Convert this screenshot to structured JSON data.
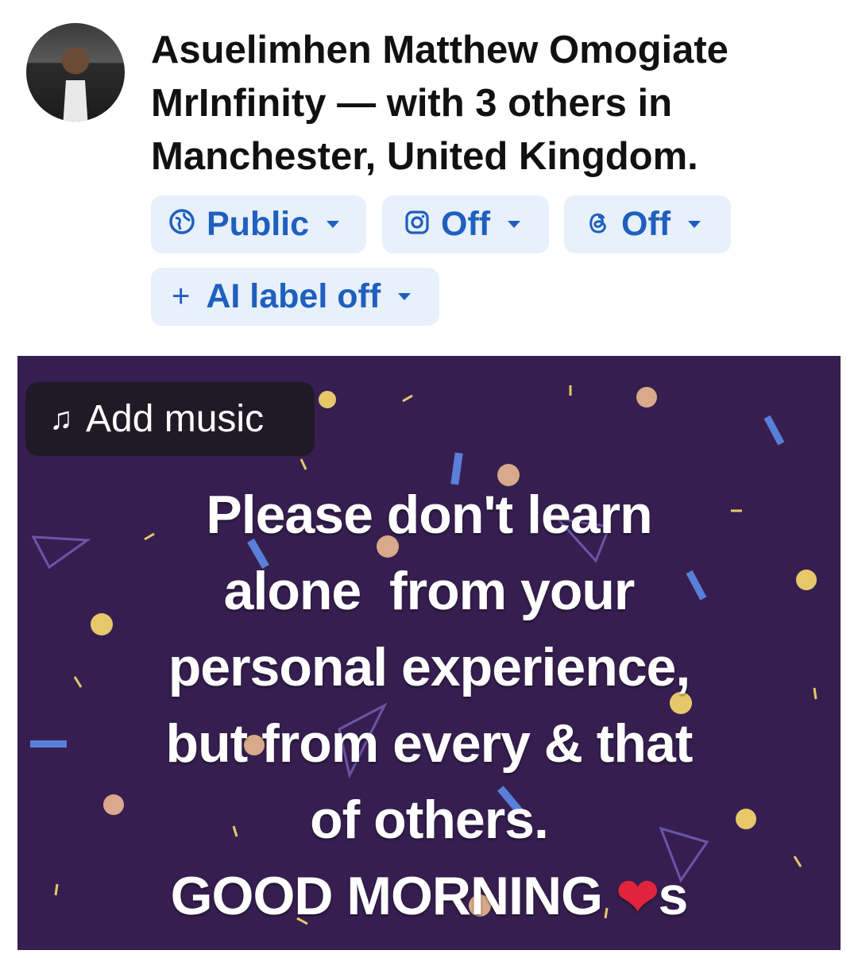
{
  "author": {
    "text": "Asuelimhen Matthew Omogiate MrInfinity — with 3 others in Manchester, United Kingdom."
  },
  "chips": {
    "audience": {
      "label": "Public",
      "icon": "globe-icon"
    },
    "instagram": {
      "label": "Off",
      "icon": "instagram-icon"
    },
    "threads": {
      "label": "Off",
      "icon": "threads-icon"
    },
    "ai_label": {
      "label": "AI label off",
      "icon": "plus-icon"
    }
  },
  "post": {
    "background_color": "#361f50",
    "add_music": "Add music",
    "lines": [
      "Please don't learn",
      "alone  from your",
      "personal experience,",
      "but from every & that",
      "of others.",
      "GOOD MORNING"
    ],
    "suffix": "s"
  }
}
